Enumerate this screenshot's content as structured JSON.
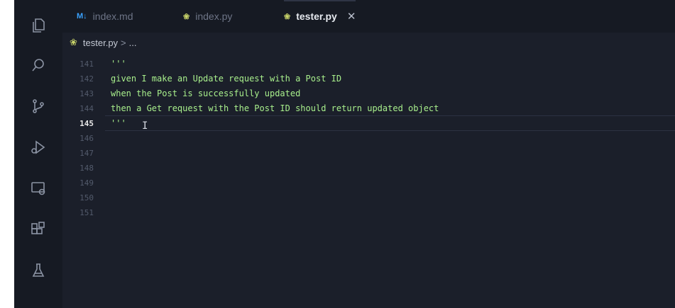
{
  "tabs": [
    {
      "label": "index.md",
      "icon": "markdown-icon",
      "icon_glyph": "M↓",
      "active": false
    },
    {
      "label": "index.py",
      "icon": "python-icon",
      "icon_glyph": "❀",
      "active": false
    },
    {
      "label": "tester.py",
      "icon": "python-icon",
      "icon_glyph": "❀",
      "active": true,
      "close": "✕"
    }
  ],
  "breadcrumb": {
    "file": "tester.py",
    "separator": ">",
    "rest": "..."
  },
  "editor": {
    "line_numbers": [
      "141",
      "142",
      "143",
      "144",
      "145",
      "146",
      "147",
      "148",
      "149",
      "150",
      "151"
    ],
    "current_line": "145",
    "lines": [
      "'''",
      "given I make an Update request with a Post ID",
      "when the Post is successfully updated",
      "then a Get request with the Post ID should return updated object",
      "'''",
      "",
      "",
      "",
      "",
      "",
      ""
    ],
    "cursor_glyph": "I"
  },
  "activity_bar": [
    "explorer-icon",
    "search-icon",
    "source-control-icon",
    "run-debug-icon",
    "remote-explorer-icon",
    "extensions-icon",
    "testing-icon"
  ],
  "colors": {
    "background": "#1b1f2a",
    "code_text": "#a8ef8c",
    "line_number": "#525a6b"
  }
}
